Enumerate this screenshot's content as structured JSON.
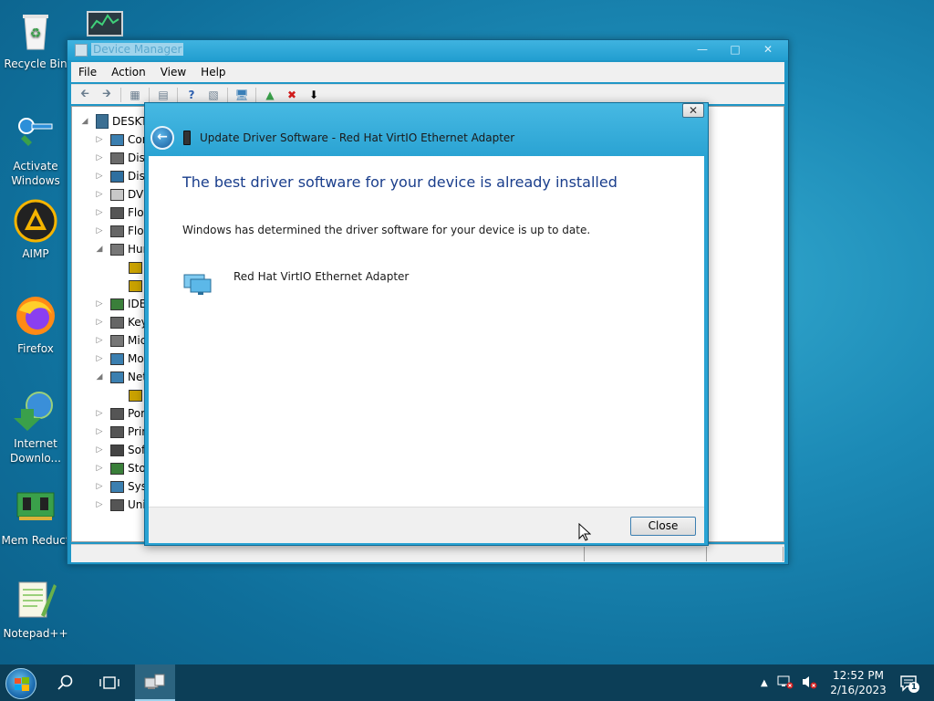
{
  "desktop": {
    "icons": [
      {
        "label": "Recycle Bin"
      },
      {
        "label": "Activate Windows"
      },
      {
        "label": "AIMP"
      },
      {
        "label": "Firefox"
      },
      {
        "label": "Internet Downlo..."
      },
      {
        "label": "Mem Reduct"
      },
      {
        "label": "Notepad++"
      }
    ]
  },
  "device_manager": {
    "title": "Device Manager",
    "menu": [
      "File",
      "Action",
      "View",
      "Help"
    ],
    "tree": {
      "root": "DESKTOP",
      "items": [
        {
          "label": "Computer"
        },
        {
          "label": "Disk drives"
        },
        {
          "label": "Display adapters"
        },
        {
          "label": "DVD/CD-ROM drives"
        },
        {
          "label": "Floppy disk drives"
        },
        {
          "label": "Floppy drive controllers"
        },
        {
          "label": "Human Interface Devices"
        },
        {
          "label": ""
        },
        {
          "label": ""
        },
        {
          "label": "IDE ATA/ATAPI controllers"
        },
        {
          "label": "Keyboards"
        },
        {
          "label": "Mice and other pointing devices"
        },
        {
          "label": "Monitors"
        },
        {
          "label": "Network adapters"
        },
        {
          "label": ""
        },
        {
          "label": "Ports (COM & LPT)"
        },
        {
          "label": "Print queues"
        },
        {
          "label": "Software devices"
        },
        {
          "label": "Storage controllers"
        },
        {
          "label": "System devices"
        },
        {
          "label": "Universal Serial Bus controllers"
        }
      ]
    }
  },
  "dialog": {
    "title": "Update Driver Software - Red Hat VirtIO Ethernet Adapter",
    "heading": "The best driver software for your device is already installed",
    "message": "Windows has determined the driver software for your device is up to date.",
    "device_name": "Red Hat VirtIO Ethernet Adapter",
    "close_label": "Close"
  },
  "taskbar": {
    "time": "12:52 PM",
    "date": "2/16/2023",
    "notification_count": "1"
  },
  "colors": {
    "desktop_bg": "#1c8ab6",
    "dialog_heading": "#1a3e8c",
    "taskbar": "#0c3e57"
  }
}
